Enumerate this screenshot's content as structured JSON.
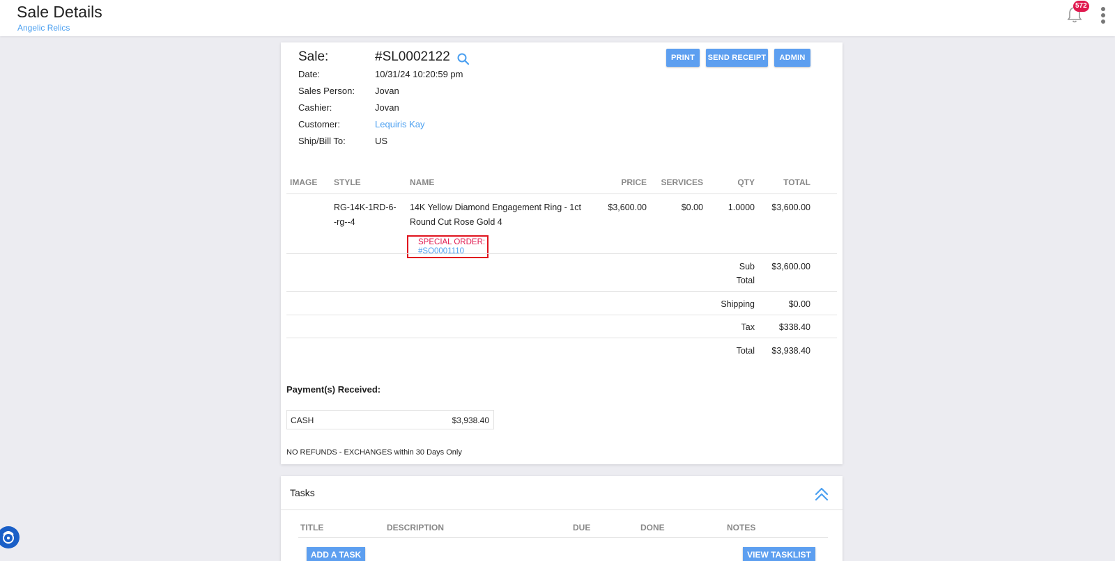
{
  "header": {
    "title": "Sale Details",
    "subtitle": "Angelic Relics",
    "notification_count": "572"
  },
  "sale": {
    "sale_label": "Sale:",
    "sale_number": "#SL0002122",
    "date_label": "Date:",
    "date_value": "10/31/24 10:20:59 pm",
    "sales_person_label": "Sales Person:",
    "sales_person_value": "Jovan",
    "cashier_label": "Cashier:",
    "cashier_value": "Jovan",
    "customer_label": "Customer:",
    "customer_value": "Lequiris Kay",
    "ship_label": "Ship/Bill To:",
    "ship_value": "US"
  },
  "actions": {
    "print": "PRINT",
    "send_receipt": "SEND RECEIPT",
    "admin": "ADMIN"
  },
  "items_table": {
    "headers": [
      "IMAGE",
      "STYLE",
      "NAME",
      "PRICE",
      "SERVICES",
      "QTY",
      "TOTAL"
    ],
    "rows": [
      {
        "style_line1": "RG-14K-1RD-6-",
        "style_line2": "-rg--4",
        "name_line1": "14K Yellow Diamond Engagement Ring - 1ct",
        "name_line2": "Round Cut Rose Gold 4",
        "special_order_label": "SPECIAL ORDER:",
        "special_order_number": "#SO0001110",
        "price": "$3,600.00",
        "services": "$0.00",
        "qty": "1.0000",
        "total": "$3,600.00"
      }
    ]
  },
  "summary": {
    "subtotal_label_1": "Sub",
    "subtotal_label_2": "Total",
    "subtotal_value": "$3,600.00",
    "shipping_label": "Shipping",
    "shipping_value": "$0.00",
    "tax_label": "Tax",
    "tax_value": "$338.40",
    "total_label": "Total",
    "total_value": "$3,938.40"
  },
  "payments": {
    "title": "Payment(s) Received:",
    "items": [
      {
        "method": "CASH",
        "amount": "$3,938.40"
      }
    ]
  },
  "policy": "NO REFUNDS - EXCHANGES within 30 Days Only",
  "tasks": {
    "title": "Tasks",
    "headers": [
      "TITLE",
      "DESCRIPTION",
      "DUE",
      "DONE",
      "NOTES"
    ],
    "add_button": "ADD A TASK",
    "view_button": "VIEW TASKLIST"
  },
  "colors": {
    "accent": "#5d9ff0",
    "link": "#4a9ff0",
    "badge": "#e0194f",
    "highlight_box": "#e0141e"
  },
  "icons": [
    "bell-icon",
    "kebab-menu-icon",
    "search-icon",
    "chevron-double-up-icon",
    "help-icon"
  ]
}
